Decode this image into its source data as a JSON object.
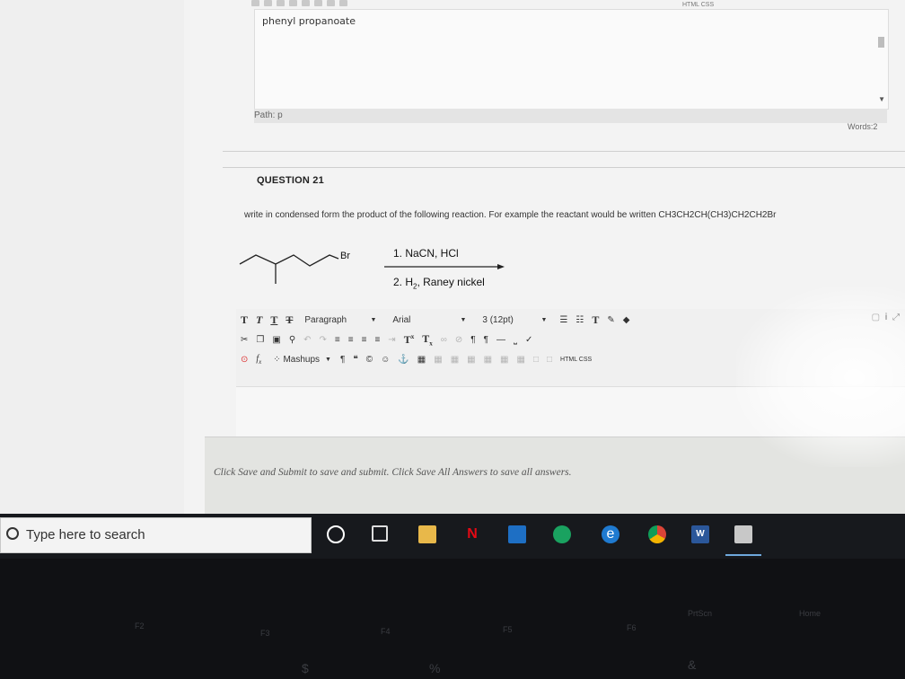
{
  "previous_answer": {
    "toolbar_label": "HTML CSS",
    "text": "phenyl propanoate",
    "path_label": "Path: p",
    "word_count": "Words:2"
  },
  "question": {
    "title": "QUESTION 21",
    "text": "write in condensed form the product of the following reaction. For example the reactant would be written CH3CH2CH(CH3)CH2CH2Br",
    "reactant_label": "Br",
    "step1": "1. NaCN, HCl",
    "step2_prefix": "2. H",
    "step2_sub": "2",
    "step2_suffix": ", Raney nickel"
  },
  "editor": {
    "format_buttons": [
      "T",
      "T",
      "T",
      "T"
    ],
    "paragraph": "Paragraph",
    "font": "Arial",
    "size": "3 (12pt)",
    "mashups": "Mashups",
    "html_css": "HTML CSS",
    "right_icons": "i"
  },
  "footer": {
    "text": "Click Save and Submit to save and submit. Click Save All Answers to save all answers."
  },
  "taskbar": {
    "search_placeholder": "Type here to search",
    "colors": {
      "accent": "#1f7ad0",
      "netflix": "#e50914",
      "mail": "#1e6fc4",
      "edge": "#1aa260",
      "chrome": "#f4b400",
      "word": "#2b579a"
    }
  },
  "keyboard": {
    "keys": [
      "F2",
      "F3",
      "F4",
      "F5",
      "F6",
      "PrtScn",
      "Home",
      "$",
      "%",
      "&"
    ]
  }
}
